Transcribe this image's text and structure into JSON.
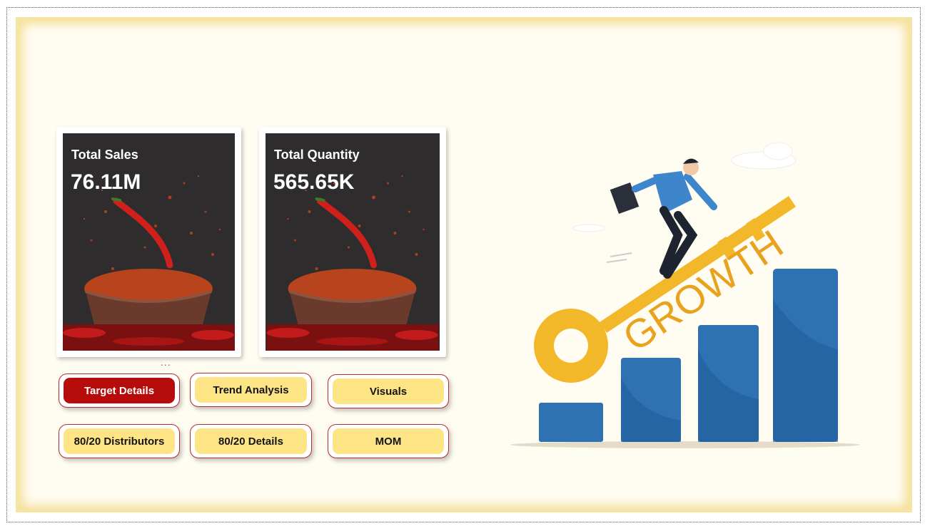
{
  "kpi_cards": [
    {
      "title": "Total Sales",
      "value": "76.11M"
    },
    {
      "title": "Total Quantity",
      "value": "565.65K"
    }
  ],
  "more_options": "...",
  "nav_buttons": [
    {
      "label": "Target Details",
      "active": true
    },
    {
      "label": "Trend Analysis",
      "active": false
    },
    {
      "label": "Visuals",
      "active": false
    },
    {
      "label": "80/20 Distributors",
      "active": false
    },
    {
      "label": "80/20 Details",
      "active": false
    },
    {
      "label": "MOM",
      "active": false
    }
  ],
  "illustration": {
    "word": "GROWTH"
  },
  "colors": {
    "panel_bg": "#fffcf2",
    "panel_glow": "#f5df98",
    "button_fill": "#fde585",
    "button_active": "#b70c0c",
    "button_border": "#b22d2d",
    "card_bg": "#2f2c2d",
    "bar_blue": "#2f72b3",
    "key_yellow": "#f3b82a"
  }
}
